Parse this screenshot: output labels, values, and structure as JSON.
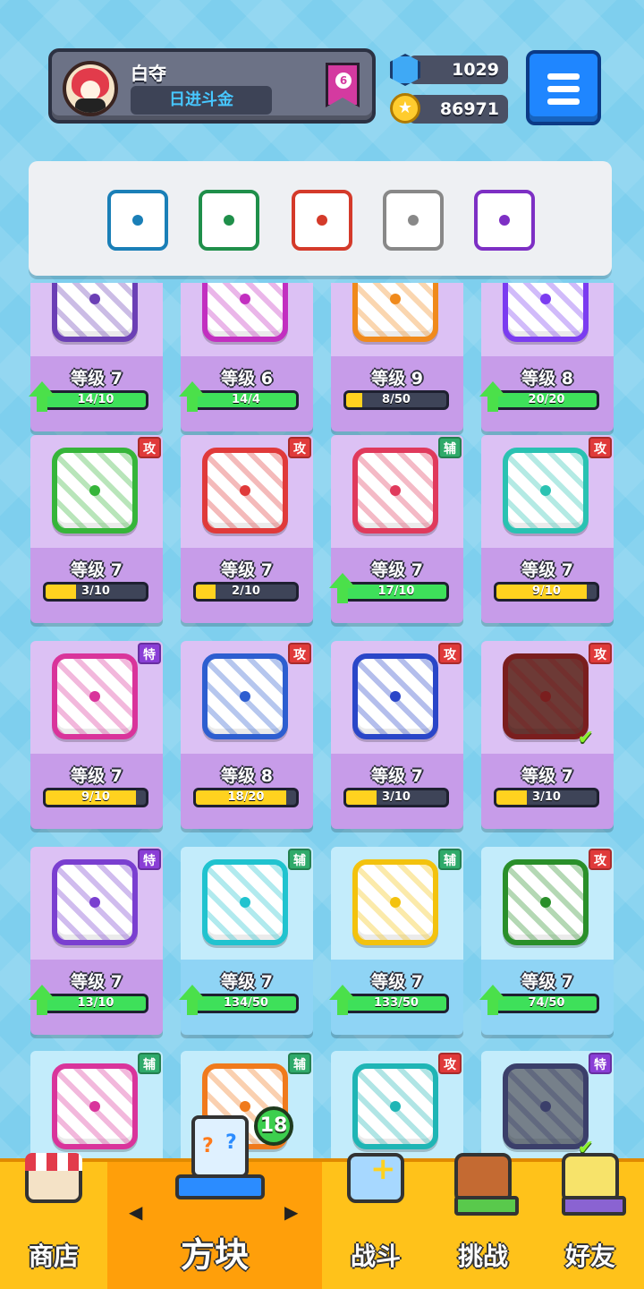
{
  "player": {
    "name": "白夺",
    "title": "日进斗金",
    "rank": "6"
  },
  "currency": {
    "gems": "1029",
    "coins": "86971"
  },
  "deck": [
    {
      "icon": "whirlwind-dice-icon",
      "color": "#1a7fb7"
    },
    {
      "icon": "wind-dice-icon",
      "color": "#1f8f4a"
    },
    {
      "icon": "fire-dice-icon",
      "color": "#d43a2a"
    },
    {
      "icon": "gear-dice-icon",
      "color": "#888888"
    },
    {
      "icon": "blessing-dice-icon",
      "color": "#7d2fc4"
    }
  ],
  "cards": [
    {
      "level": "等级 7",
      "progress": "14/10",
      "fill": 1,
      "up": true,
      "color": "#6b3fb5",
      "theme": "purple",
      "badge": ""
    },
    {
      "level": "等级 6",
      "progress": "14/4",
      "fill": 1,
      "up": true,
      "color": "#c22fc0",
      "theme": "purple",
      "badge": ""
    },
    {
      "level": "等级 9",
      "progress": "8/50",
      "fill": 0.16,
      "up": false,
      "color": "#f08a1c",
      "theme": "purple",
      "badge": ""
    },
    {
      "level": "等级 8",
      "progress": "20/20",
      "fill": 1,
      "up": true,
      "color": "#7b3cf0",
      "theme": "purple",
      "badge": ""
    },
    {
      "level": "等级 7",
      "progress": "3/10",
      "fill": 0.3,
      "up": false,
      "color": "#36b53a",
      "theme": "purple",
      "badge": "攻",
      "badgeType": "atk"
    },
    {
      "level": "等级 7",
      "progress": "2/10",
      "fill": 0.2,
      "up": false,
      "color": "#e03a3a",
      "theme": "purple",
      "badge": "攻",
      "badgeType": "atk"
    },
    {
      "level": "等级 7",
      "progress": "17/10",
      "fill": 1,
      "up": true,
      "color": "#e03a5c",
      "theme": "purple",
      "badge": "辅",
      "badgeType": "sup"
    },
    {
      "level": "等级 7",
      "progress": "9/10",
      "fill": 0.9,
      "up": false,
      "color": "#2ac2b2",
      "theme": "purple",
      "badge": "攻",
      "badgeType": "atk"
    },
    {
      "level": "等级 7",
      "progress": "9/10",
      "fill": 0.9,
      "up": false,
      "color": "#d9349b",
      "theme": "purple",
      "badge": "特",
      "badgeType": "spe"
    },
    {
      "level": "等级 8",
      "progress": "18/20",
      "fill": 0.9,
      "up": false,
      "color": "#2d5ed0",
      "theme": "purple",
      "badge": "攻",
      "badgeType": "atk"
    },
    {
      "level": "等级 7",
      "progress": "3/10",
      "fill": 0.3,
      "up": false,
      "color": "#2a46c8",
      "theme": "purple",
      "badge": "攻",
      "badgeType": "atk"
    },
    {
      "level": "等级 7",
      "progress": "3/10",
      "fill": 0.3,
      "up": false,
      "color": "#7a1e1e",
      "theme": "purple",
      "badge": "攻",
      "badgeType": "atk",
      "check": true,
      "dark": true
    },
    {
      "level": "等级 7",
      "progress": "13/10",
      "fill": 1,
      "up": true,
      "color": "#7a3fd0",
      "theme": "purple",
      "badge": "特",
      "badgeType": "spe"
    },
    {
      "level": "等级 7",
      "progress": "134/50",
      "fill": 1,
      "up": true,
      "color": "#20c3cf",
      "theme": "blue",
      "badge": "辅",
      "badgeType": "sup"
    },
    {
      "level": "等级 7",
      "progress": "133/50",
      "fill": 1,
      "up": true,
      "color": "#f3c20e",
      "theme": "blue",
      "badge": "辅",
      "badgeType": "sup"
    },
    {
      "level": "等级 7",
      "progress": "74/50",
      "fill": 1,
      "up": true,
      "color": "#2a8f2a",
      "theme": "blue",
      "badge": "攻",
      "badgeType": "atk"
    },
    {
      "level": "",
      "progress": "",
      "fill": 0,
      "up": false,
      "color": "#d9349b",
      "theme": "blue",
      "badge": "辅",
      "badgeType": "sup"
    },
    {
      "level": "",
      "progress": "",
      "fill": 0,
      "up": false,
      "color": "#f07a1c",
      "theme": "blue",
      "badge": "辅",
      "badgeType": "sup"
    },
    {
      "level": "",
      "progress": "",
      "fill": 0,
      "up": false,
      "color": "#1fb5b5",
      "theme": "blue",
      "badge": "攻",
      "badgeType": "atk"
    },
    {
      "level": "",
      "progress": "",
      "fill": 0,
      "up": false,
      "color": "#3b3f6a",
      "theme": "blue",
      "badge": "特",
      "badgeType": "spe",
      "check": true,
      "dim": true
    }
  ],
  "nav": {
    "shop": "商店",
    "dice": "方块",
    "battle": "战斗",
    "challenge": "挑战",
    "friends": "好友",
    "dice_count": "18",
    "arrow_left": "◀",
    "arrow_right": "▶"
  }
}
